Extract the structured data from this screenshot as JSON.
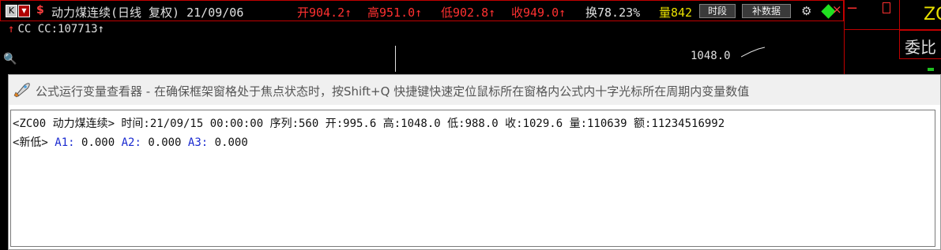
{
  "titlebar": {
    "k_button": "K",
    "arrow_button": "▼",
    "dollar_icon": "$",
    "title": "动力煤连续(日线 复权) 21/09/06",
    "open": "开904.2↑",
    "high": "高951.0↑",
    "low": "低902.8↑",
    "close": "收949.0↑",
    "turnover": "换78.23%",
    "volume": "量842",
    "period_button": "时段",
    "supplement_button": "补数据",
    "close_icon": "×"
  },
  "indicator": {
    "arrow": "↑",
    "text": "CC CC:107713↑"
  },
  "chart": {
    "price_label": "1048.0"
  },
  "right_panel": {
    "minus": "−",
    "code": "ZC",
    "wei": "委比"
  },
  "dialog": {
    "title": "公式运行变量查看器 - 在确保框架窗格处于焦点状态时，按Shift+Q 快捷键快速定位鼠标所在窗格内公式内十字光标所在周期内变量数值",
    "line1": "<ZC00 动力煤连续> 时间:21/09/15 00:00:00 序列:560 开:995.6 高:1048.0 低:988.0 收:1029.6 量:110639 额:11234516992",
    "line2_prefix": "<新低> ",
    "a1_label": "A1:",
    "a1_value": " 0.000 ",
    "a2_label": "A2:",
    "a2_value": " 0.000 ",
    "a3_label": "A3:",
    "a3_value": " 0.000"
  },
  "colors": {
    "up": "#ff3030",
    "volume": "#e8e000",
    "frame_border": "#c00000",
    "variable_label": "#1a2ad0"
  }
}
